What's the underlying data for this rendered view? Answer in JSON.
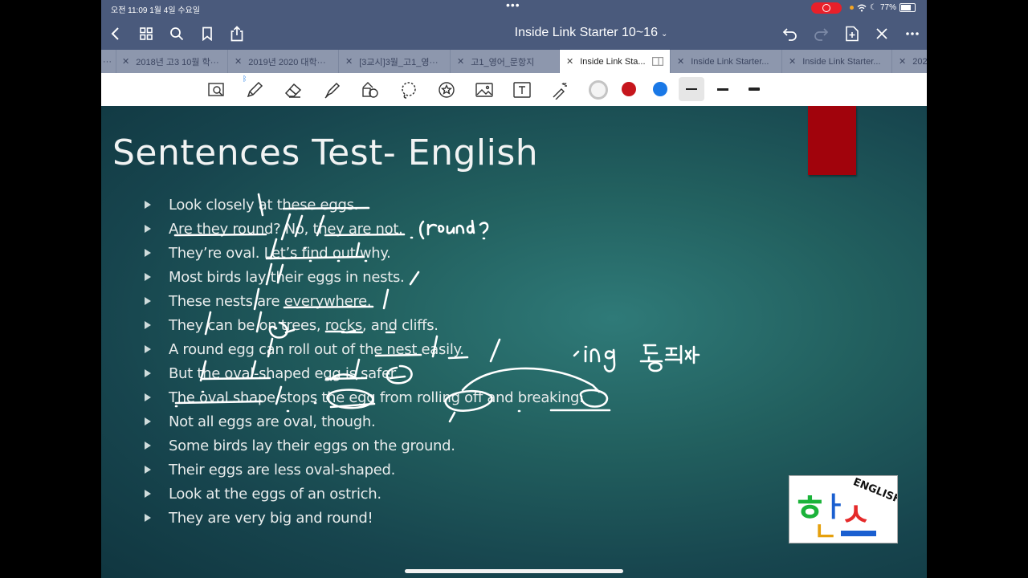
{
  "status_bar": {
    "time_date": "오전 11:09   1월 4일 수요일",
    "battery": "77%"
  },
  "nav": {
    "title": "Inside Link Starter 10~16"
  },
  "tabs": [
    {
      "label": "···",
      "active": false
    },
    {
      "label": "2018년 고3 10월 학···",
      "active": false
    },
    {
      "label": "2019년 2020 대학···",
      "active": false
    },
    {
      "label": "[3교시]3월_고1_영···",
      "active": false
    },
    {
      "label": "고1_영어_문항지",
      "active": false
    },
    {
      "label": "Inside Link Sta...",
      "active": true
    },
    {
      "label": "Inside Link Starter...",
      "active": false
    },
    {
      "label": "Inside Link Starter...",
      "active": false
    },
    {
      "label": "202",
      "active": false
    }
  ],
  "toolbar": {
    "tools": [
      "zoom-scan-icon",
      "pencil-icon",
      "eraser-icon",
      "highlighter-icon",
      "shapes-icon",
      "lasso-icon",
      "sticker-icon",
      "image-icon",
      "text-box-icon",
      "laser-pointer-icon"
    ],
    "colors": [
      "#f4f4f4",
      "#c6161d",
      "#1a78e6"
    ]
  },
  "slide": {
    "title": "Sentences Test- English",
    "sentences": [
      "Look closely at these eggs.",
      "Are they round? No, they are not.",
      "They’re oval. Let’s find out why.",
      "Most birds lay their eggs in nests.",
      "These nests are everywhere.",
      "They can be on trees, rocks, and cliffs.",
      "A round egg can roll out of the nest easily.",
      "But the oval-shaped egg is safer.",
      "The oval shape stops the egg from rolling off and breaking.",
      "Not all eggs are oval, though.",
      "Some birds lay their eggs on the ground.",
      "Their eggs are less oval-shaped.",
      "Look at the eggs of an ostrich.",
      "They are very big and round!"
    ],
    "handwriting": {
      "note1": "(round?",
      "note2": "-ing 동명사"
    },
    "logo": {
      "korean": "한스",
      "english": "ENGLISH"
    }
  }
}
